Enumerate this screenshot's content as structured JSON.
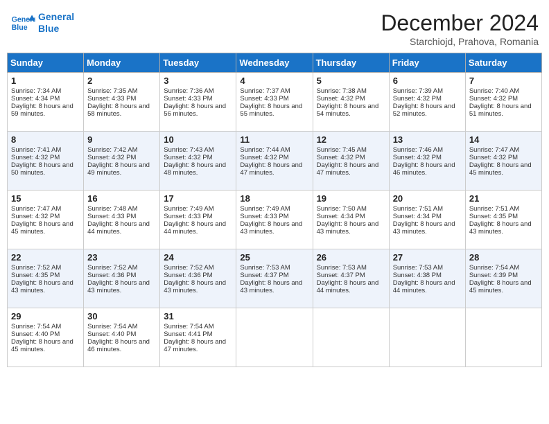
{
  "header": {
    "logo_text_top": "General",
    "logo_text_bottom": "Blue",
    "month_title": "December 2024",
    "subtitle": "Starchiojd, Prahova, Romania"
  },
  "weekdays": [
    "Sunday",
    "Monday",
    "Tuesday",
    "Wednesday",
    "Thursday",
    "Friday",
    "Saturday"
  ],
  "weeks": [
    [
      {
        "day": "1",
        "sunrise": "7:34 AM",
        "sunset": "4:34 PM",
        "daylight": "8 hours and 59 minutes."
      },
      {
        "day": "2",
        "sunrise": "7:35 AM",
        "sunset": "4:33 PM",
        "daylight": "8 hours and 58 minutes."
      },
      {
        "day": "3",
        "sunrise": "7:36 AM",
        "sunset": "4:33 PM",
        "daylight": "8 hours and 56 minutes."
      },
      {
        "day": "4",
        "sunrise": "7:37 AM",
        "sunset": "4:33 PM",
        "daylight": "8 hours and 55 minutes."
      },
      {
        "day": "5",
        "sunrise": "7:38 AM",
        "sunset": "4:32 PM",
        "daylight": "8 hours and 54 minutes."
      },
      {
        "day": "6",
        "sunrise": "7:39 AM",
        "sunset": "4:32 PM",
        "daylight": "8 hours and 52 minutes."
      },
      {
        "day": "7",
        "sunrise": "7:40 AM",
        "sunset": "4:32 PM",
        "daylight": "8 hours and 51 minutes."
      }
    ],
    [
      {
        "day": "8",
        "sunrise": "7:41 AM",
        "sunset": "4:32 PM",
        "daylight": "8 hours and 50 minutes."
      },
      {
        "day": "9",
        "sunrise": "7:42 AM",
        "sunset": "4:32 PM",
        "daylight": "8 hours and 49 minutes."
      },
      {
        "day": "10",
        "sunrise": "7:43 AM",
        "sunset": "4:32 PM",
        "daylight": "8 hours and 48 minutes."
      },
      {
        "day": "11",
        "sunrise": "7:44 AM",
        "sunset": "4:32 PM",
        "daylight": "8 hours and 47 minutes."
      },
      {
        "day": "12",
        "sunrise": "7:45 AM",
        "sunset": "4:32 PM",
        "daylight": "8 hours and 47 minutes."
      },
      {
        "day": "13",
        "sunrise": "7:46 AM",
        "sunset": "4:32 PM",
        "daylight": "8 hours and 46 minutes."
      },
      {
        "day": "14",
        "sunrise": "7:47 AM",
        "sunset": "4:32 PM",
        "daylight": "8 hours and 45 minutes."
      }
    ],
    [
      {
        "day": "15",
        "sunrise": "7:47 AM",
        "sunset": "4:32 PM",
        "daylight": "8 hours and 45 minutes."
      },
      {
        "day": "16",
        "sunrise": "7:48 AM",
        "sunset": "4:33 PM",
        "daylight": "8 hours and 44 minutes."
      },
      {
        "day": "17",
        "sunrise": "7:49 AM",
        "sunset": "4:33 PM",
        "daylight": "8 hours and 44 minutes."
      },
      {
        "day": "18",
        "sunrise": "7:49 AM",
        "sunset": "4:33 PM",
        "daylight": "8 hours and 43 minutes."
      },
      {
        "day": "19",
        "sunrise": "7:50 AM",
        "sunset": "4:34 PM",
        "daylight": "8 hours and 43 minutes."
      },
      {
        "day": "20",
        "sunrise": "7:51 AM",
        "sunset": "4:34 PM",
        "daylight": "8 hours and 43 minutes."
      },
      {
        "day": "21",
        "sunrise": "7:51 AM",
        "sunset": "4:35 PM",
        "daylight": "8 hours and 43 minutes."
      }
    ],
    [
      {
        "day": "22",
        "sunrise": "7:52 AM",
        "sunset": "4:35 PM",
        "daylight": "8 hours and 43 minutes."
      },
      {
        "day": "23",
        "sunrise": "7:52 AM",
        "sunset": "4:36 PM",
        "daylight": "8 hours and 43 minutes."
      },
      {
        "day": "24",
        "sunrise": "7:52 AM",
        "sunset": "4:36 PM",
        "daylight": "8 hours and 43 minutes."
      },
      {
        "day": "25",
        "sunrise": "7:53 AM",
        "sunset": "4:37 PM",
        "daylight": "8 hours and 43 minutes."
      },
      {
        "day": "26",
        "sunrise": "7:53 AM",
        "sunset": "4:37 PM",
        "daylight": "8 hours and 44 minutes."
      },
      {
        "day": "27",
        "sunrise": "7:53 AM",
        "sunset": "4:38 PM",
        "daylight": "8 hours and 44 minutes."
      },
      {
        "day": "28",
        "sunrise": "7:54 AM",
        "sunset": "4:39 PM",
        "daylight": "8 hours and 45 minutes."
      }
    ],
    [
      {
        "day": "29",
        "sunrise": "7:54 AM",
        "sunset": "4:40 PM",
        "daylight": "8 hours and 45 minutes."
      },
      {
        "day": "30",
        "sunrise": "7:54 AM",
        "sunset": "4:40 PM",
        "daylight": "8 hours and 46 minutes."
      },
      {
        "day": "31",
        "sunrise": "7:54 AM",
        "sunset": "4:41 PM",
        "daylight": "8 hours and 47 minutes."
      },
      null,
      null,
      null,
      null
    ]
  ],
  "labels": {
    "sunrise": "Sunrise:",
    "sunset": "Sunset:",
    "daylight": "Daylight:"
  }
}
